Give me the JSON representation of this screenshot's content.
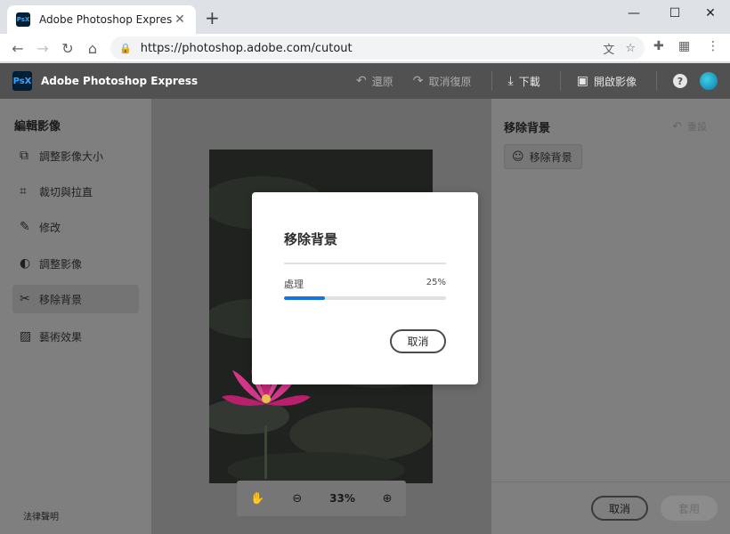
{
  "browser": {
    "tab_title": "Adobe Photoshop Express",
    "favicon_text": "PsX",
    "url": "https://photoshop.adobe.com/cutout"
  },
  "app": {
    "logo_text": "PsX",
    "name": "Adobe Photoshop Express",
    "actions": {
      "undo": "還原",
      "redo": "取消復原",
      "download": "下載",
      "open_image": "開啟影像"
    },
    "help_label": "?"
  },
  "left_panel": {
    "title": "編輯影像",
    "items": [
      {
        "label": "調整影像大小",
        "icon": "resize-icon"
      },
      {
        "label": "裁切與拉直",
        "icon": "crop-icon"
      },
      {
        "label": "修改",
        "icon": "bandage-icon"
      },
      {
        "label": "調整影像",
        "icon": "adjust-icon"
      },
      {
        "label": "移除背景",
        "icon": "scissors-icon",
        "active": true
      },
      {
        "label": "藝術效果",
        "icon": "art-effects-icon"
      }
    ],
    "legal": "法律聲明"
  },
  "canvas": {
    "zoom": "33%"
  },
  "right_panel": {
    "title": "移除背景",
    "reset_label": "重設",
    "chip_label": "移除背景",
    "cancel_label": "取消",
    "apply_label": "套用"
  },
  "modal": {
    "title": "移除背景",
    "status_label": "處理",
    "percent_text": "25%",
    "progress": 0.25,
    "cancel_label": "取消"
  },
  "colors": {
    "accent": "#1473e6",
    "appbar": "#515151"
  }
}
